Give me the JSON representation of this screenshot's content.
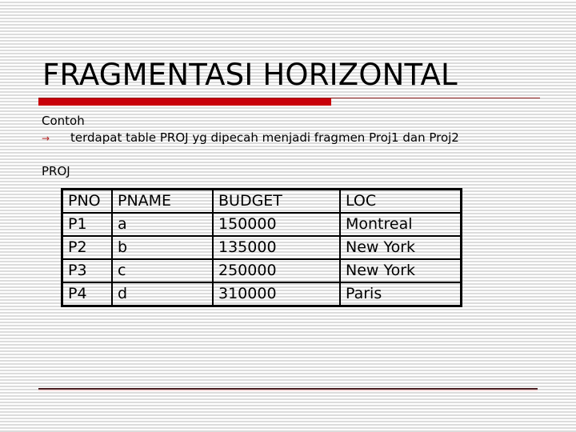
{
  "slide": {
    "title": "FRAGMENTASI HORIZONTAL",
    "accent_color": "#c8000a",
    "intro_label": "Contoh",
    "bullet": {
      "icon": "right-arrow-icon",
      "glyph": "→",
      "text": "terdapat table PROJ yg dipecah menjadi fragmen Proj1 dan Proj2"
    },
    "table_label": "PROJ",
    "table": {
      "columns": [
        "PNO",
        "PNAME",
        "BUDGET",
        "LOC"
      ],
      "rows": [
        [
          "P1",
          "a",
          "150000",
          "Montreal"
        ],
        [
          "P2",
          "b",
          "135000",
          "New York"
        ],
        [
          "P3",
          "c",
          "250000",
          "New York"
        ],
        [
          "P4",
          "d",
          "310000",
          "Paris"
        ]
      ]
    }
  }
}
